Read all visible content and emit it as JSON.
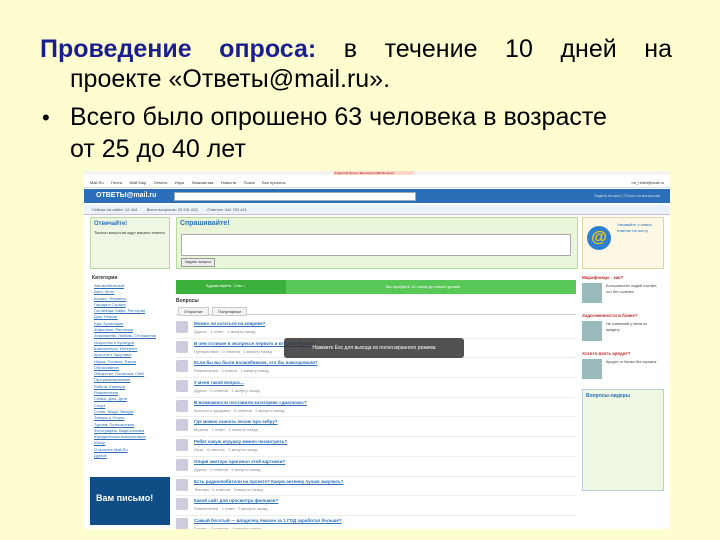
{
  "slide": {
    "line1_bold": "Проведение опроса:",
    "line1_rest": " в течение 10 дней на",
    "line2": "проекте «Ответы@mail.ru».",
    "bullet": "•",
    "line3": "Всего было опрошено 63 человека в возрасте",
    "line4": "от 25 до 40 лет"
  },
  "screenshot": {
    "topbar_text": "Открытый Пульс | Бесплатно Mail.Ru Агент",
    "nav": [
      "Mail.Ru",
      "Почта",
      "Мой Мир",
      "Ответы",
      "Игры",
      "Знакомства",
      "Новости",
      "Поиск",
      "Все проекты"
    ],
    "nav_right": "mr_relish@mail.ru",
    "logo": "ОТВЕТЫ@mail.ru",
    "header_links": "Задать вопрос | Поиск по вопросам",
    "stats": [
      "Сейчас на сайте: 12 444",
      "Всего вопросов: 25 531 632",
      "Ответов: 444 753 421"
    ],
    "answer_box": {
      "title": "Отвечайте!",
      "text": "Тысячи вопросов ждут вашего ответа!"
    },
    "categories_title": "Категории",
    "categories": [
      "Автомобильный",
      "Авто, Мото",
      "Бизнес, Финансы",
      "Города и Страны",
      "Гостиница, Кафе, Ресторан",
      "Дом, Ремонт",
      "Еда, Кулинария",
      "Животные, Растения",
      "Знакомства, Любовь, Отношения",
      "Искусство и Культура",
      "Компьютеры, Интернет",
      "Красота и Здоровье",
      "Наука, Техника, Языки",
      "Образование",
      "Общество, Политика, СМИ",
      "Программирование",
      "Работа, Карьера",
      "Развлечения",
      "Семья, Дом, Дети",
      "Спорт",
      "Стиль, Мода, Звезды",
      "Товары и Услуги",
      "Туризм, Путешествия",
      "Фотография, Видеосъемка",
      "Юридическая консультация",
      "Юмор",
      "О проекте Mail.Ru",
      "Другое"
    ],
    "promo": "Вам письмо!",
    "ask_title": "Спрашивайте!",
    "ask_button": "Задать вопрос",
    "green_left": "Здравствуйте, Стас !",
    "green_right": "Вы пройдёте 10 очков до нового уровня",
    "questions_title": "Вопросы",
    "tabs": [
      "Открытые",
      "Популярные"
    ],
    "questions": [
      {
        "t": "Можно ли кататься на коврике?",
        "m": "Другое · 1 ответ · 1 минуту назад"
      },
      {
        "t": "В чем отличие в экспрессе первого и второго класса?",
        "m": "Путешествия · 0 ответов · 1 минуту назад"
      },
      {
        "t": "Если бы вы были волшебником, что бы наколдовали?",
        "m": "Развлечения · 2 ответа · 1 минуту назад"
      },
      {
        "t": "У меня такой вопрос...",
        "m": "Другое · 0 ответов · 1 минуту назад"
      },
      {
        "t": "В возможности поставили категорию «диагноза»?",
        "m": "Красота и здоровье · 0 ответов · 2 минуты назад"
      },
      {
        "t": "Где можно скачать песню про зебру?",
        "m": "Музыка · 1 ответ · 2 минуты назад"
      },
      {
        "t": "Ребят какую игрушку можно посмотреть?",
        "m": "Игры · 0 ответов · 2 минуты назад"
      },
      {
        "t": "Опция аватора оригинал этой картинки?",
        "m": "Другое · 0 ответов · 3 минуты назад"
      },
      {
        "t": "Есть радиолюбители на проекте? Какую антенну лучше закупить?",
        "m": "Техника · 0 ответов · 3 минуты назад"
      },
      {
        "t": "Какой сайт для просмотра фильмов?",
        "m": "Развлечения · 1 ответ · 3 минуты назад"
      },
      {
        "t": "Самый богатый — владелец Амазон за 1 ГОД заработал больше?",
        "m": "Бизнес · 0 ответов · 4 минуты назад"
      }
    ],
    "overlay": "Нажмите Esc для выхода из полноэкранного режима",
    "right_ad": "Узнавайте о новых ответах на почту",
    "right_sections": [
      {
        "h": "Марафонцы - как?",
        "tx": "Большинство людей считает, что бег полезен"
      },
      {
        "h": "Задолженности в банке?",
        "tx": "Не сомнений у меня по кредиту"
      },
      {
        "h": "Хотите взять кредит?",
        "tx": "Кредит от банка без справок"
      }
    ],
    "leaders_title": "Вопросы-лидеры"
  }
}
